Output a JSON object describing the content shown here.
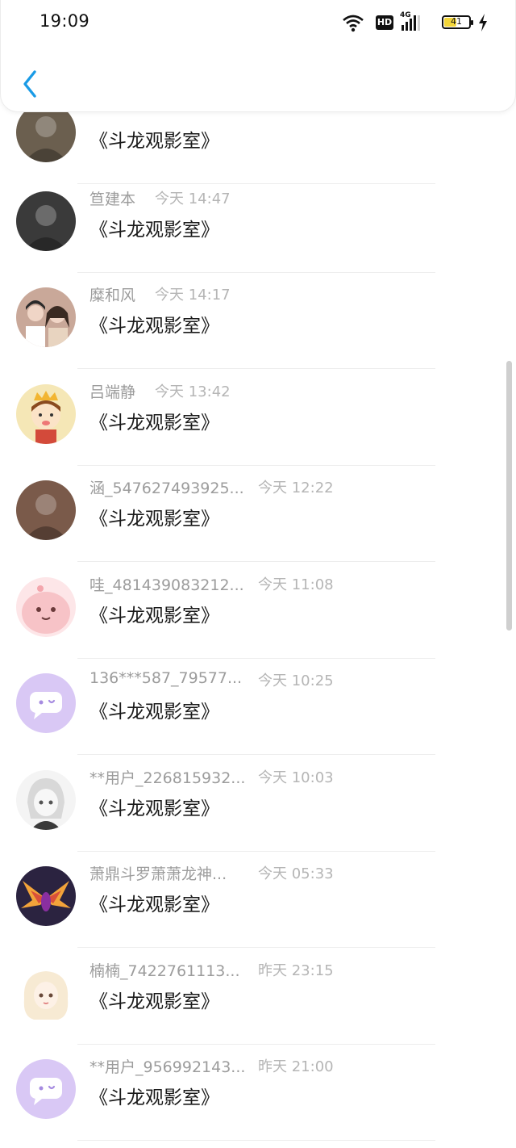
{
  "status_bar": {
    "time": "19:09",
    "battery": "41",
    "network": "4G",
    "hd": "HD"
  },
  "list": {
    "items": [
      {
        "name": "",
        "time": "",
        "message": "《斗龙观影室》",
        "avatar": "photo-avatar-icon",
        "color": "#6b5f4f"
      },
      {
        "name": "笪建本",
        "time": "今天 14:47",
        "message": "《斗龙观影室》",
        "avatar": "photo-avatar-icon",
        "color": "#3a3a3a"
      },
      {
        "name": "糜和风",
        "time": "今天 14:17",
        "message": "《斗龙观影室》",
        "avatar": "couple-photo-avatar-icon",
        "color": "#c9a899"
      },
      {
        "name": "吕端静",
        "time": "今天 13:42",
        "message": "《斗龙观影室》",
        "avatar": "cartoon-prince-avatar-icon",
        "color": "#f5e7b6"
      },
      {
        "name": "涵_547627493925...",
        "time": "今天 12:22",
        "message": "《斗龙观影室》",
        "avatar": "photo-avatar-icon",
        "color": "#7a5a4a"
      },
      {
        "name": "哇_481439083212...",
        "time": "今天 11:08",
        "message": "《斗龙观影室》",
        "avatar": "pink-cartoon-avatar-icon",
        "color": "#f7c3c7"
      },
      {
        "name": "136***587_79577...",
        "time": "今天 10:25",
        "message": "《斗龙观影室》",
        "avatar": "default-chat-avatar-icon",
        "color": "#d9c8f5"
      },
      {
        "name": "**用户_226815932...",
        "time": "今天 10:03",
        "message": "《斗龙观影室》",
        "avatar": "anime-avatar-icon",
        "color": "#d8d8d8"
      },
      {
        "name": "萧鼎斗罗萧萧龙神...",
        "time": "今天 05:33",
        "message": "《斗龙观影室》",
        "avatar": "dragon-avatar-icon",
        "color": "#2b2340"
      },
      {
        "name": "楠楠_7422761113...",
        "time": "昨天 23:15",
        "message": "《斗龙观影室》",
        "avatar": "anime-girl-avatar-icon",
        "color": "#f7ead3"
      },
      {
        "name": "**用户_956992143...",
        "time": "昨天 21:00",
        "message": "《斗龙观影室》",
        "avatar": "default-chat-avatar-icon",
        "color": "#d9c8f5"
      }
    ]
  },
  "colors": {
    "accent": "#1a9be6",
    "default_avatar": "#d9c8f5"
  }
}
